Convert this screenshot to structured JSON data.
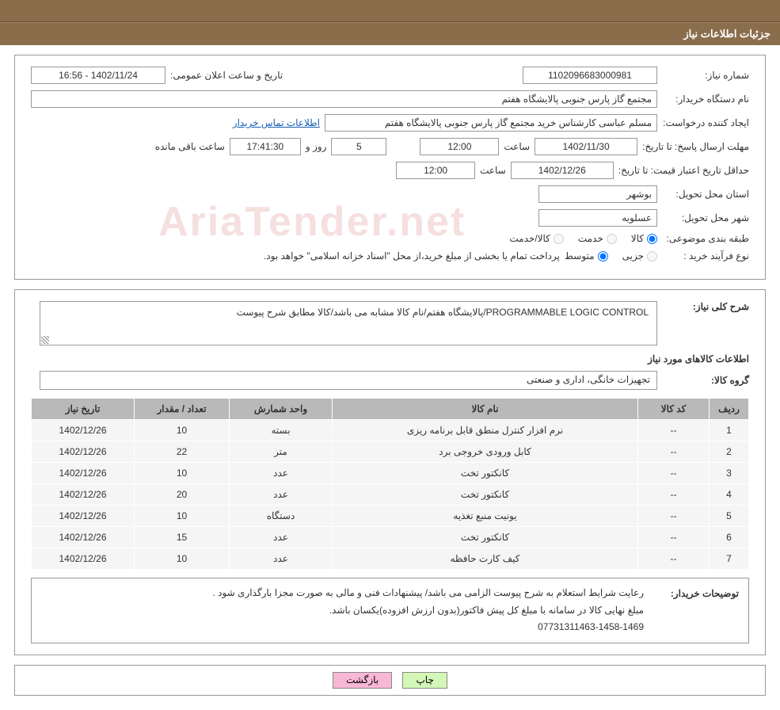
{
  "titlebar": "جزئیات اطلاعات نیاز",
  "labels": {
    "reqNo": "شماره نیاز:",
    "annDate": "تاریخ و ساعت اعلان عمومی:",
    "buyerOrg": "نام دستگاه خریدار:",
    "creator": "ایجاد کننده درخواست:",
    "contactLink": "اطلاعات تماس خریدار",
    "deadline": "مهلت ارسال پاسخ:",
    "until": "تا تاریخ:",
    "hour": "ساعت",
    "days": "روز و",
    "remain": "ساعت باقی مانده",
    "validity": "حداقل تاریخ اعتبار قیمت:",
    "province": "استان محل تحویل:",
    "city": "شهر محل تحویل:",
    "subject": "طبقه بندی موضوعی:",
    "kala": "کالا",
    "khadamat": "خدمت",
    "kalakhadamat": "کالا/خدمت",
    "purchaseType": "نوع فرآیند خرید :",
    "partial": "جزیی",
    "medium": "متوسط",
    "purchaseNote": "پرداخت تمام یا بخشی از مبلغ خرید،از محل \"اسناد خزانه اسلامی\" خواهد بود.",
    "needDesc": "شرح کلی نیاز:",
    "itemsHeader": "اطلاعات کالاهای مورد نیاز",
    "group": "گروه کالا:",
    "buyerNotes": "توضیحات خریدار:",
    "print": "چاپ",
    "back": "بازگشت"
  },
  "values": {
    "reqNo": "1102096683000981",
    "annDate": "1402/11/24 - 16:56",
    "buyerOrg": "مجتمع گاز پارس جنوبی  پالایشگاه هفتم",
    "creator": "مسلم عباسی کارشناس خرید مجتمع گاز پارس جنوبی  پالایشگاه هفتم",
    "deadlineDate": "1402/11/30",
    "deadlineTime": "12:00",
    "days": "5",
    "remainTime": "17:41:30",
    "validityDate": "1402/12/26",
    "validityTime": "12:00",
    "province": "بوشهر",
    "city": "عسلویه",
    "needDesc": "PROGRAMMABLE LOGIC CONTROL/پالایشگاه هفتم/نام کالا مشابه می باشد/کالا مطابق شرح پیوست",
    "group": "تجهیزات خانگی، اداری و صنعتی",
    "buyerNotes1": "رعایت شرایط استعلام به شرح پیوست الزامی می باشد/ پیشنهادات فنی و مالی به صورت مجزا بارگذاری شود .",
    "buyerNotes2": "مبلغ نهایی کالا در سامانه با مبلغ کل پیش فاکتور(بدون ارزش افزوده)یکسان باشد.",
    "buyerNotes3": "07731311463-1458-1469"
  },
  "table": {
    "headers": {
      "row": "ردیف",
      "code": "کد کالا",
      "name": "نام کالا",
      "unit": "واحد شمارش",
      "qty": "تعداد / مقدار",
      "date": "تاریخ نیاز"
    },
    "rows": [
      {
        "n": "1",
        "code": "--",
        "name": "نرم افزار کنترل منطق قابل برنامه ریزی",
        "unit": "بسته",
        "qty": "10",
        "date": "1402/12/26"
      },
      {
        "n": "2",
        "code": "--",
        "name": "کابل ورودی خروجی برد",
        "unit": "متر",
        "qty": "22",
        "date": "1402/12/26"
      },
      {
        "n": "3",
        "code": "--",
        "name": "کانکتور تخت",
        "unit": "عدد",
        "qty": "10",
        "date": "1402/12/26"
      },
      {
        "n": "4",
        "code": "--",
        "name": "کانکتور تخت",
        "unit": "عدد",
        "qty": "20",
        "date": "1402/12/26"
      },
      {
        "n": "5",
        "code": "--",
        "name": "یونیت منبع تغذیه",
        "unit": "دستگاه",
        "qty": "10",
        "date": "1402/12/26"
      },
      {
        "n": "6",
        "code": "--",
        "name": "کانکتور تخت",
        "unit": "عدد",
        "qty": "15",
        "date": "1402/12/26"
      },
      {
        "n": "7",
        "code": "--",
        "name": "کیف کارت حافظه",
        "unit": "عدد",
        "qty": "10",
        "date": "1402/12/26"
      }
    ]
  },
  "watermark": "AriaTender.net"
}
